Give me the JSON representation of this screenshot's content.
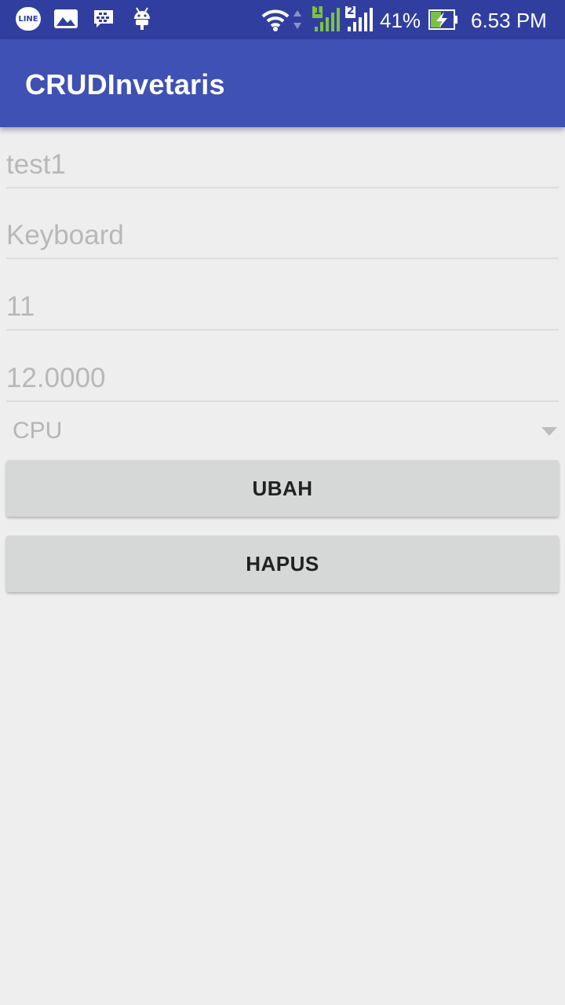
{
  "status_bar": {
    "icons": [
      "line-icon",
      "gallery-icon",
      "bbm-icon",
      "android-icon",
      "wifi-icon",
      "data-arrows-icon",
      "signal-sim1-icon",
      "signal-sim2-icon",
      "battery-charging-icon"
    ],
    "line_label": "LINE",
    "sim1_label": "1",
    "sim2_label": "2",
    "battery_percent": "41%",
    "time": "6.53 PM",
    "background": "#303F9F"
  },
  "app_bar": {
    "title": "CRUDInvetaris",
    "color": "#3F51B5"
  },
  "form": {
    "fields": [
      {
        "value": "test1"
      },
      {
        "value": "Keyboard"
      },
      {
        "value": "11"
      },
      {
        "value": "12.0000"
      }
    ],
    "spinner": {
      "selected": "CPU"
    }
  },
  "buttons": {
    "update_label": "UBAH",
    "delete_label": "HAPUS"
  }
}
